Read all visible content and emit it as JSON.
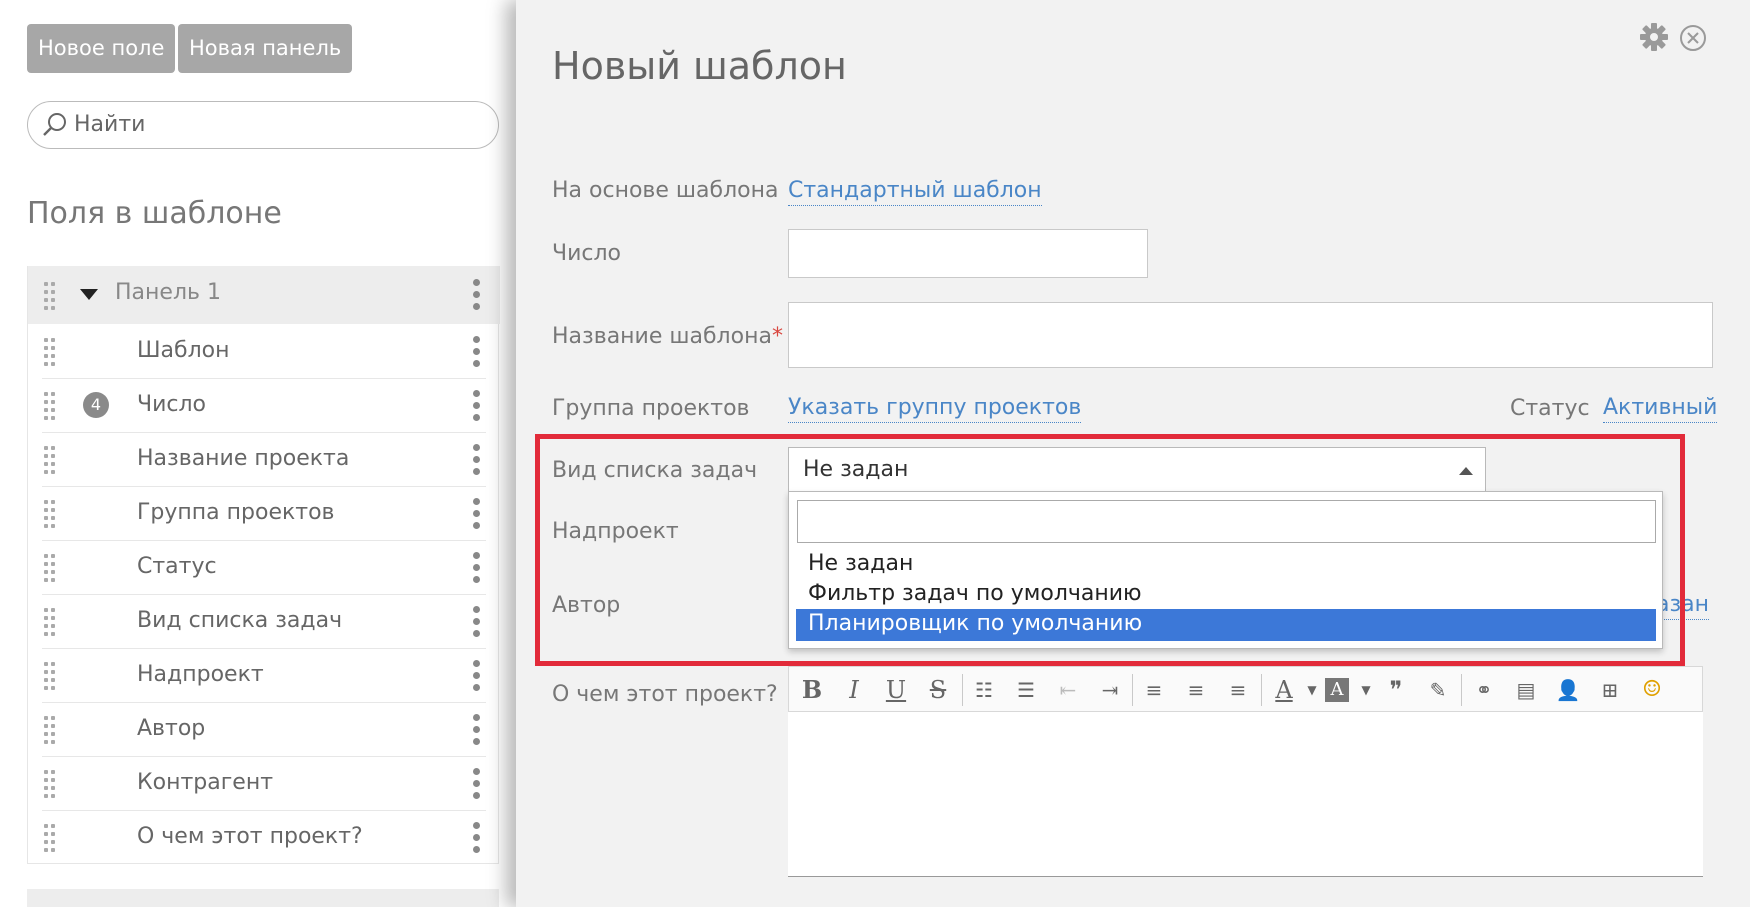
{
  "left_panel": {
    "new_field_button": "Новое поле",
    "new_panel_button": "Новая панель",
    "search_placeholder": "Найти",
    "section_title": "Поля в шаблоне",
    "panel_name": "Панель 1",
    "items": [
      {
        "label": "Шаблон"
      },
      {
        "label": "Число",
        "badge": "4"
      },
      {
        "label": "Название проекта"
      },
      {
        "label": "Группа проектов"
      },
      {
        "label": "Статус"
      },
      {
        "label": "Вид списка задач"
      },
      {
        "label": "Надпроект"
      },
      {
        "label": "Автор"
      },
      {
        "label": "Контрагент"
      },
      {
        "label": "О чем этот проект?"
      }
    ]
  },
  "modal": {
    "title": "Новый шаблон",
    "based_on_label": "На основе шаблона",
    "based_on_link": "Стандартный шаблон",
    "number_label": "Число",
    "number_value": "",
    "template_name_label": "Название шаблона",
    "required_mark": "*",
    "template_name_value": "",
    "project_group_label": "Группа проектов",
    "project_group_link": "Указать группу проектов",
    "status_label": "Статус",
    "status_link": "Активный",
    "task_list_label": "Вид списка задач",
    "task_list_value": "Не задан",
    "parent_project_label": "Надпроект",
    "author_label": "Автор",
    "author_link_partial": "азан",
    "about_label": "О чем этот проект?",
    "dropdown": {
      "search_value": "",
      "options": [
        {
          "label": "Не задан",
          "selected": false
        },
        {
          "label": "Фильтр задач по умолчанию",
          "selected": false
        },
        {
          "label": "Планировщик по умолчанию",
          "selected": true
        }
      ]
    }
  },
  "colors": {
    "link": "#4a86c7",
    "selection": "#3c78d8",
    "highlight_border": "#e22b3a",
    "button_gray": "#a7a7a7"
  }
}
